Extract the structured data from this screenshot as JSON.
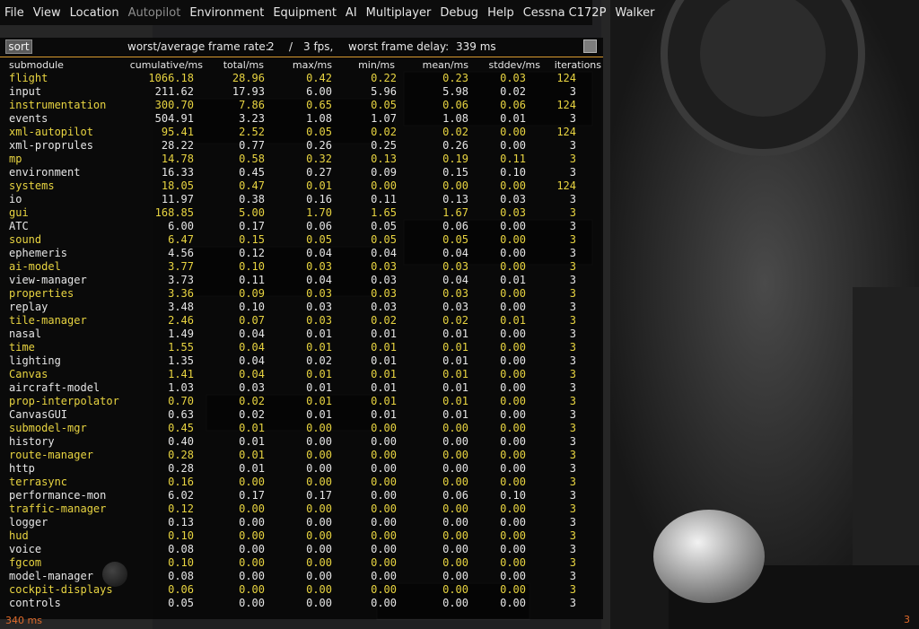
{
  "menu": [
    {
      "label": "File",
      "enabled": true
    },
    {
      "label": "View",
      "enabled": true
    },
    {
      "label": "Location",
      "enabled": true
    },
    {
      "label": "Autopilot",
      "enabled": false
    },
    {
      "label": "Environment",
      "enabled": true
    },
    {
      "label": "Equipment",
      "enabled": true
    },
    {
      "label": "AI",
      "enabled": true
    },
    {
      "label": "Multiplayer",
      "enabled": true
    },
    {
      "label": "Debug",
      "enabled": true
    },
    {
      "label": "Help",
      "enabled": true
    },
    {
      "label": "Cessna C172P",
      "enabled": true
    },
    {
      "label": "Walker",
      "enabled": true
    }
  ],
  "perf": {
    "sort_label": "sort",
    "frame_rate_label": "worst/average frame rate:",
    "worst_fps": "2",
    "separator": "/",
    "avg_fps": "3 fps,",
    "frame_delay_label": "worst frame delay:",
    "frame_delay_value": "339 ms",
    "columns": {
      "submodule": "submodule",
      "cumulative": "cumulative/ms",
      "total": "total/ms",
      "max": "max/ms",
      "min": "min/ms",
      "mean": "mean/ms",
      "stddev": "stddev/ms",
      "iterations": "iterations"
    },
    "rows": [
      {
        "name": "flight",
        "cum": "1066.18",
        "tot": "28.96",
        "max": "0.42",
        "min": "0.22",
        "mean": "0.23",
        "sd": "0.03",
        "it": "124"
      },
      {
        "name": "input",
        "cum": "211.62",
        "tot": "17.93",
        "max": "6.00",
        "min": "5.96",
        "mean": "5.98",
        "sd": "0.02",
        "it": "3"
      },
      {
        "name": "instrumentation",
        "cum": "300.70",
        "tot": "7.86",
        "max": "0.65",
        "min": "0.05",
        "mean": "0.06",
        "sd": "0.06",
        "it": "124"
      },
      {
        "name": "events",
        "cum": "504.91",
        "tot": "3.23",
        "max": "1.08",
        "min": "1.07",
        "mean": "1.08",
        "sd": "0.01",
        "it": "3"
      },
      {
        "name": "xml-autopilot",
        "cum": "95.41",
        "tot": "2.52",
        "max": "0.05",
        "min": "0.02",
        "mean": "0.02",
        "sd": "0.00",
        "it": "124"
      },
      {
        "name": "xml-proprules",
        "cum": "28.22",
        "tot": "0.77",
        "max": "0.26",
        "min": "0.25",
        "mean": "0.26",
        "sd": "0.00",
        "it": "3"
      },
      {
        "name": "mp",
        "cum": "14.78",
        "tot": "0.58",
        "max": "0.32",
        "min": "0.13",
        "mean": "0.19",
        "sd": "0.11",
        "it": "3"
      },
      {
        "name": "environment",
        "cum": "16.33",
        "tot": "0.45",
        "max": "0.27",
        "min": "0.09",
        "mean": "0.15",
        "sd": "0.10",
        "it": "3"
      },
      {
        "name": "systems",
        "cum": "18.05",
        "tot": "0.47",
        "max": "0.01",
        "min": "0.00",
        "mean": "0.00",
        "sd": "0.00",
        "it": "124"
      },
      {
        "name": "io",
        "cum": "11.97",
        "tot": "0.38",
        "max": "0.16",
        "min": "0.11",
        "mean": "0.13",
        "sd": "0.03",
        "it": "3"
      },
      {
        "name": "gui",
        "cum": "168.85",
        "tot": "5.00",
        "max": "1.70",
        "min": "1.65",
        "mean": "1.67",
        "sd": "0.03",
        "it": "3"
      },
      {
        "name": "ATC",
        "cum": "6.00",
        "tot": "0.17",
        "max": "0.06",
        "min": "0.05",
        "mean": "0.06",
        "sd": "0.00",
        "it": "3"
      },
      {
        "name": "sound",
        "cum": "6.47",
        "tot": "0.15",
        "max": "0.05",
        "min": "0.05",
        "mean": "0.05",
        "sd": "0.00",
        "it": "3"
      },
      {
        "name": "ephemeris",
        "cum": "4.56",
        "tot": "0.12",
        "max": "0.04",
        "min": "0.04",
        "mean": "0.04",
        "sd": "0.00",
        "it": "3"
      },
      {
        "name": "ai-model",
        "cum": "3.77",
        "tot": "0.10",
        "max": "0.03",
        "min": "0.03",
        "mean": "0.03",
        "sd": "0.00",
        "it": "3"
      },
      {
        "name": "view-manager",
        "cum": "3.73",
        "tot": "0.11",
        "max": "0.04",
        "min": "0.03",
        "mean": "0.04",
        "sd": "0.01",
        "it": "3"
      },
      {
        "name": "properties",
        "cum": "3.36",
        "tot": "0.09",
        "max": "0.03",
        "min": "0.03",
        "mean": "0.03",
        "sd": "0.00",
        "it": "3"
      },
      {
        "name": "replay",
        "cum": "3.48",
        "tot": "0.10",
        "max": "0.03",
        "min": "0.03",
        "mean": "0.03",
        "sd": "0.00",
        "it": "3"
      },
      {
        "name": "tile-manager",
        "cum": "2.46",
        "tot": "0.07",
        "max": "0.03",
        "min": "0.02",
        "mean": "0.02",
        "sd": "0.01",
        "it": "3"
      },
      {
        "name": "nasal",
        "cum": "1.49",
        "tot": "0.04",
        "max": "0.01",
        "min": "0.01",
        "mean": "0.01",
        "sd": "0.00",
        "it": "3"
      },
      {
        "name": "time",
        "cum": "1.55",
        "tot": "0.04",
        "max": "0.01",
        "min": "0.01",
        "mean": "0.01",
        "sd": "0.00",
        "it": "3"
      },
      {
        "name": "lighting",
        "cum": "1.35",
        "tot": "0.04",
        "max": "0.02",
        "min": "0.01",
        "mean": "0.01",
        "sd": "0.00",
        "it": "3"
      },
      {
        "name": "Canvas",
        "cum": "1.41",
        "tot": "0.04",
        "max": "0.01",
        "min": "0.01",
        "mean": "0.01",
        "sd": "0.00",
        "it": "3"
      },
      {
        "name": "aircraft-model",
        "cum": "1.03",
        "tot": "0.03",
        "max": "0.01",
        "min": "0.01",
        "mean": "0.01",
        "sd": "0.00",
        "it": "3"
      },
      {
        "name": "prop-interpolator",
        "cum": "0.70",
        "tot": "0.02",
        "max": "0.01",
        "min": "0.01",
        "mean": "0.01",
        "sd": "0.00",
        "it": "3"
      },
      {
        "name": "CanvasGUI",
        "cum": "0.63",
        "tot": "0.02",
        "max": "0.01",
        "min": "0.01",
        "mean": "0.01",
        "sd": "0.00",
        "it": "3"
      },
      {
        "name": "submodel-mgr",
        "cum": "0.45",
        "tot": "0.01",
        "max": "0.00",
        "min": "0.00",
        "mean": "0.00",
        "sd": "0.00",
        "it": "3"
      },
      {
        "name": "history",
        "cum": "0.40",
        "tot": "0.01",
        "max": "0.00",
        "min": "0.00",
        "mean": "0.00",
        "sd": "0.00",
        "it": "3"
      },
      {
        "name": "route-manager",
        "cum": "0.28",
        "tot": "0.01",
        "max": "0.00",
        "min": "0.00",
        "mean": "0.00",
        "sd": "0.00",
        "it": "3"
      },
      {
        "name": "http",
        "cum": "0.28",
        "tot": "0.01",
        "max": "0.00",
        "min": "0.00",
        "mean": "0.00",
        "sd": "0.00",
        "it": "3"
      },
      {
        "name": "terrasync",
        "cum": "0.16",
        "tot": "0.00",
        "max": "0.00",
        "min": "0.00",
        "mean": "0.00",
        "sd": "0.00",
        "it": "3"
      },
      {
        "name": "performance-mon",
        "cum": "6.02",
        "tot": "0.17",
        "max": "0.17",
        "min": "0.00",
        "mean": "0.06",
        "sd": "0.10",
        "it": "3"
      },
      {
        "name": "traffic-manager",
        "cum": "0.12",
        "tot": "0.00",
        "max": "0.00",
        "min": "0.00",
        "mean": "0.00",
        "sd": "0.00",
        "it": "3"
      },
      {
        "name": "logger",
        "cum": "0.13",
        "tot": "0.00",
        "max": "0.00",
        "min": "0.00",
        "mean": "0.00",
        "sd": "0.00",
        "it": "3"
      },
      {
        "name": "hud",
        "cum": "0.10",
        "tot": "0.00",
        "max": "0.00",
        "min": "0.00",
        "mean": "0.00",
        "sd": "0.00",
        "it": "3"
      },
      {
        "name": "voice",
        "cum": "0.08",
        "tot": "0.00",
        "max": "0.00",
        "min": "0.00",
        "mean": "0.00",
        "sd": "0.00",
        "it": "3"
      },
      {
        "name": "fgcom",
        "cum": "0.10",
        "tot": "0.00",
        "max": "0.00",
        "min": "0.00",
        "mean": "0.00",
        "sd": "0.00",
        "it": "3"
      },
      {
        "name": "model-manager",
        "cum": "0.08",
        "tot": "0.00",
        "max": "0.00",
        "min": "0.00",
        "mean": "0.00",
        "sd": "0.00",
        "it": "3"
      },
      {
        "name": "cockpit-displays",
        "cum": "0.06",
        "tot": "0.00",
        "max": "0.00",
        "min": "0.00",
        "mean": "0.00",
        "sd": "0.00",
        "it": "3"
      },
      {
        "name": "controls",
        "cum": "0.05",
        "tot": "0.00",
        "max": "0.00",
        "min": "0.00",
        "mean": "0.00",
        "sd": "0.00",
        "it": "3"
      }
    ]
  },
  "status": {
    "frame_time": "340 ms",
    "counter": "3"
  },
  "colors": {
    "odd_row": "#e6e6e6",
    "even_row": "#e8d441",
    "status": "#e06a2a"
  }
}
